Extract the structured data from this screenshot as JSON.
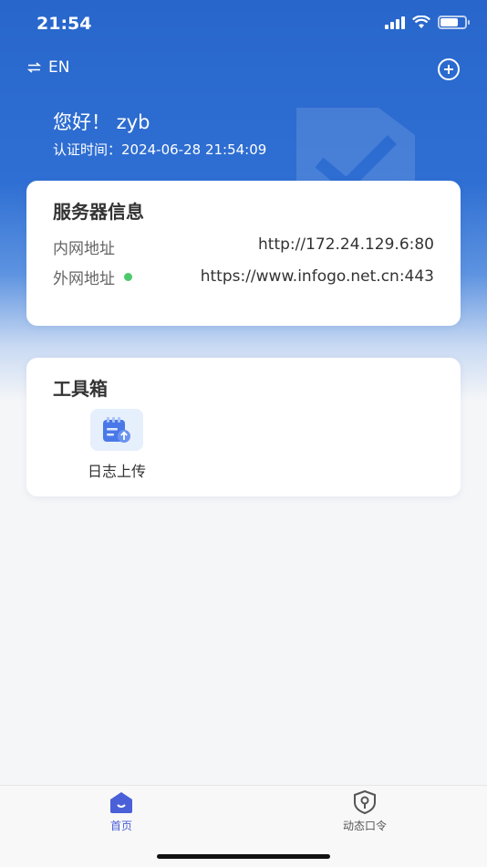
{
  "status": {
    "time": "21:54"
  },
  "header": {
    "lang_label": "EN"
  },
  "user": {
    "greeting": "您好！ zyb",
    "auth_time": "认证时间：2024-06-28 21:54:09"
  },
  "server_info": {
    "title": "服务器信息",
    "internal_label": "内网地址",
    "internal_value": "http://172.24.129.6:80",
    "external_label": "外网地址",
    "external_value": "https://www.infogo.net.cn:443",
    "external_status_color": "#4cca6b"
  },
  "toolbox": {
    "title": "工具箱",
    "items": [
      {
        "label": "日志上传",
        "icon": "log-upload-icon"
      }
    ]
  },
  "tabbar": {
    "tabs": [
      {
        "label": "首页",
        "icon": "home-icon",
        "active": true
      },
      {
        "label": "动态口令",
        "icon": "shield-key-icon",
        "active": false
      }
    ]
  },
  "colors": {
    "accent": "#2866cc",
    "tab_active": "#4a60d8"
  }
}
